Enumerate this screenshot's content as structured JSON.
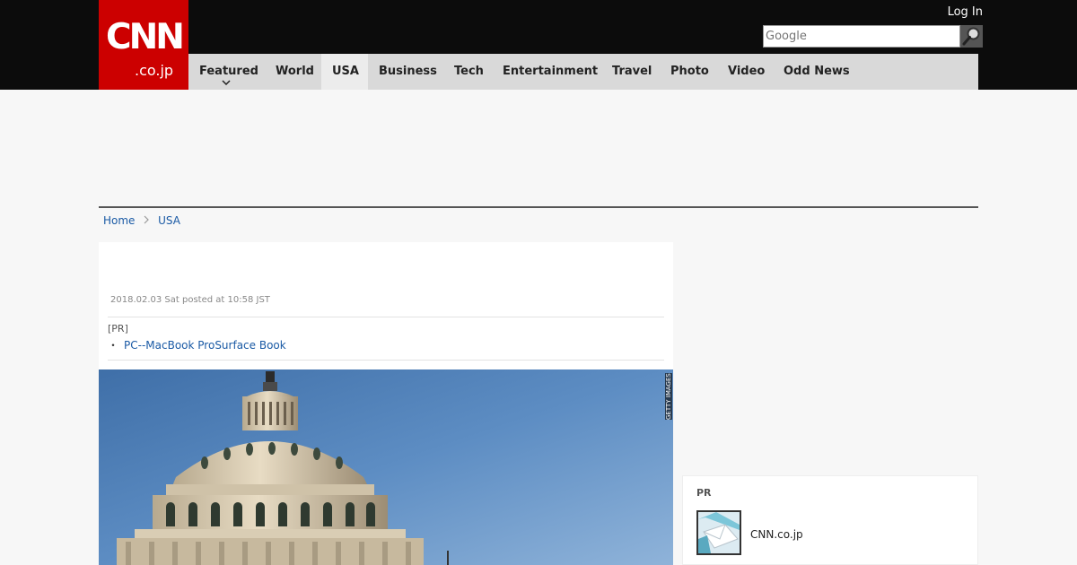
{
  "header": {
    "logo_main": "CNN",
    "logo_sub": ".co.jp",
    "login_label": "Log In",
    "search_placeholder": "Google",
    "brand_color": "#cc0000"
  },
  "nav": {
    "items": [
      {
        "label": "Featured",
        "has_dropdown": true
      },
      {
        "label": "World"
      },
      {
        "label": "USA",
        "active": true
      },
      {
        "label": "Business"
      },
      {
        "label": "Tech"
      },
      {
        "label": "Entertainment"
      },
      {
        "label": "Travel"
      },
      {
        "label": "Photo"
      },
      {
        "label": "Video"
      },
      {
        "label": "Odd News"
      }
    ]
  },
  "breadcrumb": {
    "home": "Home",
    "current": "USA"
  },
  "article": {
    "posted": "2018.02.03 Sat posted at 10:58 JST",
    "pr_tag": "[PR]",
    "pr_bullet": "・",
    "pr_link": "PC--MacBook ProSurface Book",
    "photo_credit": "GETTY IMAGES"
  },
  "sidebar": {
    "pr_label": "PR",
    "pr_item_name": "CNN.co.jp"
  },
  "icons": {
    "search": "magnifier-icon",
    "dropdown": "chevron-down-icon",
    "breadcrumb_sep": "chevron-right-icon",
    "thumbnail": "envelope-icon"
  }
}
